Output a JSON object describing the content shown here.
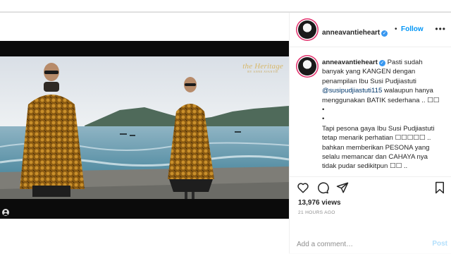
{
  "header": {
    "username": "anneavantieheart",
    "separator": "•",
    "follow_label": "Follow",
    "more_icon": "more-horizontal-icon"
  },
  "video": {
    "watermark_title": "the Heritage",
    "watermark_sub": "BY ANNE AVANTIE"
  },
  "caption": {
    "username": "anneavantieheart",
    "lines": [
      "Pasti sudah",
      "banyak yang KANGEN dengan",
      "penampilan Ibu Susi Pudjiastuti",
      "walaupun hanya",
      "menggunakan BATIK sederhana .. ☐☐",
      "•",
      "•",
      "Tapi pesona gaya Ibu Susi Pudjiastuti",
      "tetap menarik perhatian ☐☐☐☐☐ ..",
      "bahkan memberikan PESONA yang",
      "selalu memancar dan CAHAYA nya",
      "tidak pudar sedikitpun ☐☐ .."
    ],
    "mention": "@susipudjiastuti115"
  },
  "actions": {
    "like_icon": "heart-icon",
    "comment_icon": "comment-icon",
    "share_icon": "share-icon",
    "save_icon": "bookmark-icon",
    "views": "13,976 views",
    "time_ago": "21 HOURS AGO"
  },
  "comment_box": {
    "placeholder": "Add a comment…",
    "post_label": "Post"
  },
  "colors": {
    "accent": "#0095f6",
    "verified": "#3897f0",
    "watermark": "#d8b86a",
    "muted": "#8e8e8e"
  }
}
